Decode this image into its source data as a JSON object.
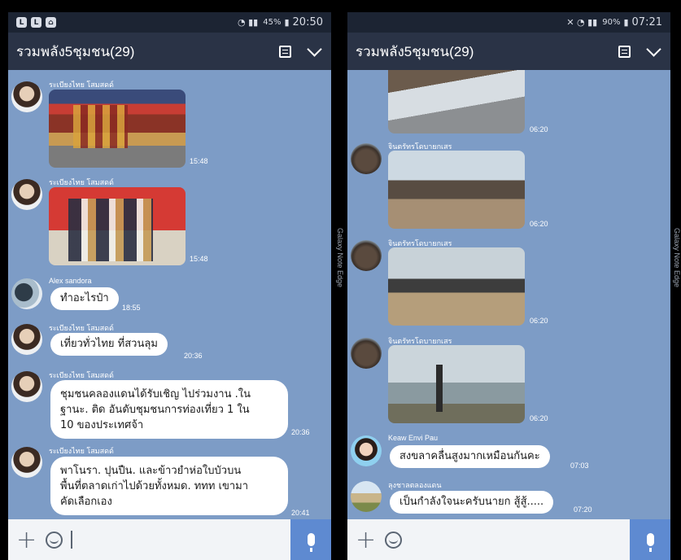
{
  "left": {
    "status": {
      "percent": "45%",
      "time": "20:50"
    },
    "title": "รวมพลัง5ชุมชน(29)",
    "messages": [
      {
        "type": "photo",
        "sender": "ระเบียงไทย โสมสดด์",
        "time": "15:48"
      },
      {
        "type": "photo",
        "sender": "ระเบียงไทย โสมสดด์",
        "time": "15:48"
      },
      {
        "type": "text",
        "sender": "Alex sandora",
        "text": "ทำอะไรป๋า",
        "time": "18:55"
      },
      {
        "type": "text",
        "sender": "ระเบียงไทย โสมสดด์",
        "text": "เที่ยวทั่วไทย ที่สวนลุม",
        "time": "20:36"
      },
      {
        "type": "text",
        "sender": "ระเบียงไทย โสมสดด์",
        "text": "ชุมชนคลองแดนได้รับเชิญ ไปร่วมงาน .ใน\nฐานะ. ติด อันดับชุมชนการท่องเที่ยว  1 ใน\n10 ของประเทศจ้า",
        "time": "20:36"
      },
      {
        "type": "text",
        "sender": "ระเบียงไทย โสมสดด์",
        "text": "พาโนรา. ปุนปืน. และข้าวยำห่อใบบัวบน\nพื้นที่ตลาดเก่าไปด้วยทั้งหมด. ททท เขามา\nคัดเลือกเอง",
        "time": "20:41"
      }
    ]
  },
  "right": {
    "status": {
      "percent": "90%",
      "time": "07:21"
    },
    "title": "รวมพลัง5ชุมชน(29)",
    "messages": [
      {
        "type": "photo",
        "sender": "",
        "time": "06:20"
      },
      {
        "type": "photo",
        "sender": "จินตรัทรโดบายกเสร",
        "time": "06:20"
      },
      {
        "type": "photo",
        "sender": "จินตรัทรโดบายกเสร",
        "time": "06:20"
      },
      {
        "type": "photo",
        "sender": "จินตรัทรโดบายกเสร",
        "time": "06:20"
      },
      {
        "type": "text",
        "sender": "Keaw Envi Pau",
        "text": "สงขลาคลื่นสูงมากเหมือนกันคะ",
        "time": "07:03"
      },
      {
        "type": "text",
        "sender": "ลุงชาลตลองแดน",
        "text": "เป็นกำลังใจนะครับนายก สู้สู้.....",
        "time": "07:20"
      }
    ]
  },
  "edge_text": {
    "left": "Galaxy Note Edge",
    "right": "Galaxy Note Edge"
  }
}
